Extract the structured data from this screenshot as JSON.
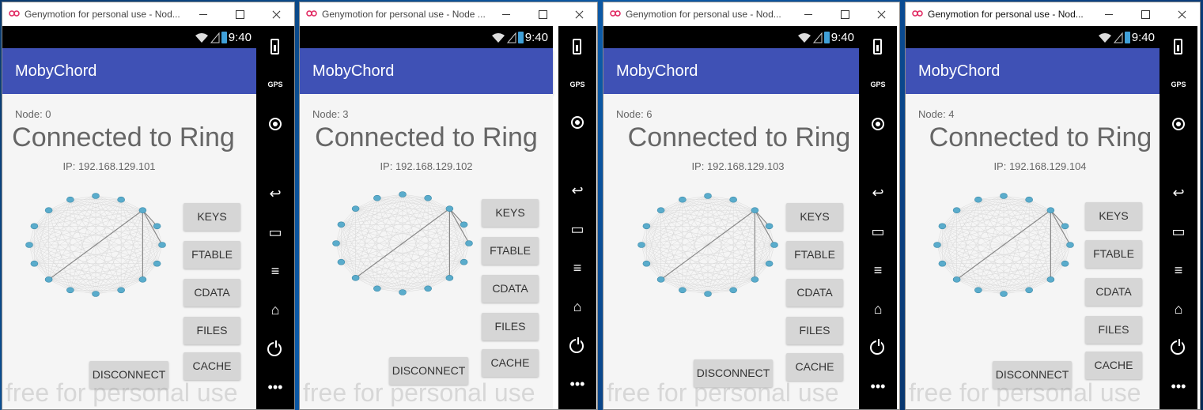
{
  "windows": [
    {
      "title": "Genymotion for personal use - Nod...",
      "time": "9:40",
      "app_title": "MobyChord",
      "node": "Node: 0",
      "status": "Connected to Ring",
      "ip": "IP: 192.168.129.101",
      "buttons": [
        "KEYS",
        "FTABLE",
        "CDATA",
        "FILES",
        "CACHE"
      ],
      "disconnect": "DISCONNECT",
      "watermark": "free for personal use"
    },
    {
      "title": "Genymotion for personal use - Node ...",
      "time": "9:40",
      "app_title": "MobyChord",
      "node": "Node: 3",
      "status": "Connected to Ring",
      "ip": "IP: 192.168.129.102",
      "buttons": [
        "KEYS",
        "FTABLE",
        "CDATA",
        "FILES",
        "CACHE"
      ],
      "disconnect": "DISCONNECT",
      "watermark": "free for personal use"
    },
    {
      "title": "Genymotion for personal use - Nod...",
      "time": "9:40",
      "app_title": "MobyChord",
      "node": "Node: 6",
      "status": "Connected to Ring",
      "ip": "IP: 192.168.129.103",
      "buttons": [
        "KEYS",
        "FTABLE",
        "CDATA",
        "FILES",
        "CACHE"
      ],
      "disconnect": "DISCONNECT",
      "watermark": "free for personal use"
    },
    {
      "title": "Genymotion for personal use - Nod...",
      "time": "9:40",
      "app_title": "MobyChord",
      "node": "Node: 4",
      "status": "Connected to Ring",
      "ip": "IP: 192.168.129.104",
      "buttons": [
        "KEYS",
        "FTABLE",
        "CDATA",
        "FILES",
        "CACHE"
      ],
      "disconnect": "DISCONNECT",
      "watermark": "free for personal use"
    }
  ],
  "sidebar": {
    "gps_label": "GPS"
  },
  "colors": {
    "appbar": "#3f51b5",
    "ring_node": "#5aaccc",
    "ring_link": "#888888"
  },
  "icons": [
    "battery-icon",
    "gps-icon",
    "webcam-icon",
    "back-icon",
    "recent-apps-icon",
    "menu-icon",
    "home-icon",
    "power-icon",
    "more-icon"
  ]
}
